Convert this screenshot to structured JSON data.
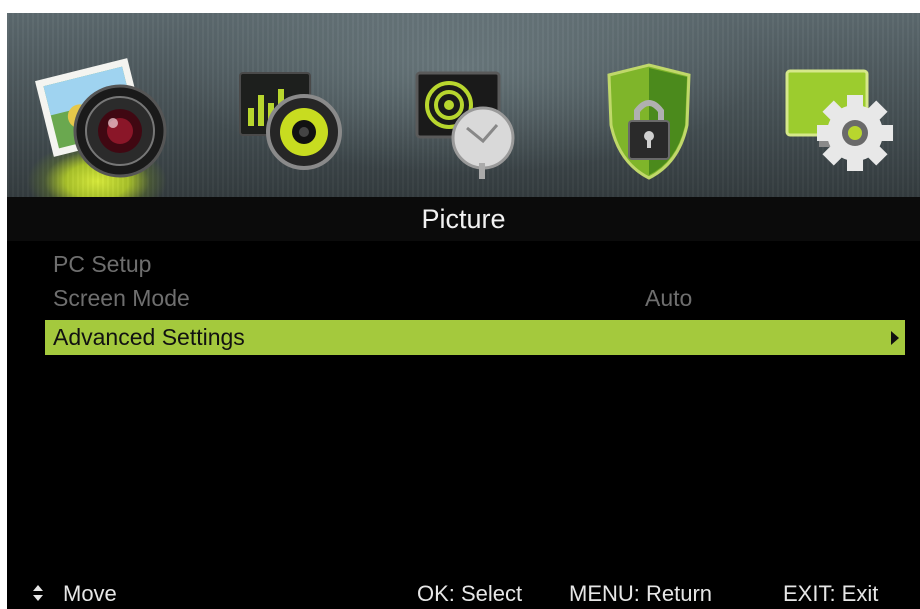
{
  "menu": {
    "tabs": [
      {
        "icon": "picture-camera-icon",
        "active": true
      },
      {
        "icon": "sound-speaker-icon",
        "active": false
      },
      {
        "icon": "channel-satellite-icon",
        "active": false
      },
      {
        "icon": "lock-shield-icon",
        "active": false
      },
      {
        "icon": "setup-gear-icon",
        "active": false
      }
    ],
    "title": "Picture",
    "items": [
      {
        "label": "PC Setup",
        "value": "",
        "state": "disabled"
      },
      {
        "label": "Screen Mode",
        "value": "Auto",
        "state": "disabled"
      },
      {
        "label": "Advanced Settings",
        "value": "",
        "state": "selected",
        "has_submenu": true
      }
    ]
  },
  "footer": {
    "move": "Move",
    "ok": "OK: Select",
    "menu": "MENU: Return",
    "exit": "EXIT: Exit"
  },
  "colors": {
    "highlight": "#a4c93d",
    "disabled_text": "#6e6e6e",
    "background": "#000000",
    "accent_glow": "#d7ea3a"
  }
}
